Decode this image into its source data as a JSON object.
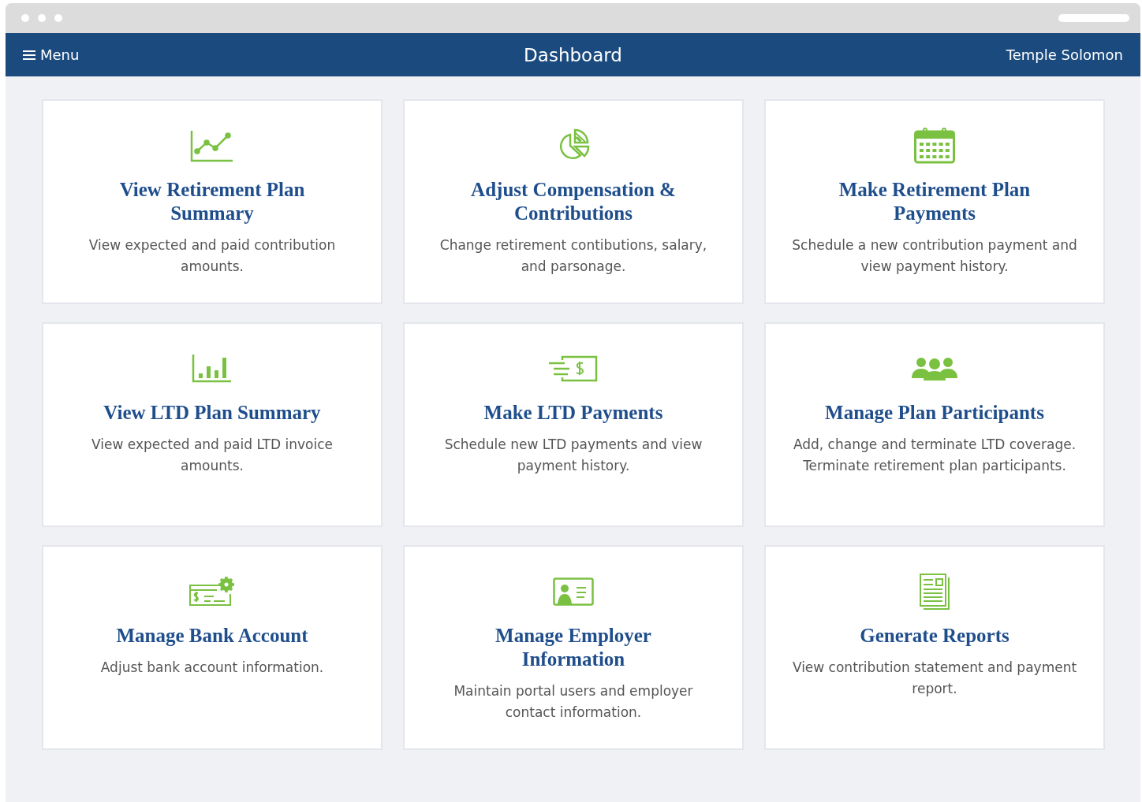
{
  "header": {
    "menu_label": "Menu",
    "title": "Dashboard",
    "user": "Temple Solomon"
  },
  "cards": [
    {
      "title": "View Retirement Plan Summary",
      "description": "View expected and paid contribution amounts."
    },
    {
      "title": "Adjust Compensation & Contributions",
      "description": "Change retirement contibutions, salary, and parsonage."
    },
    {
      "title": "Make Retirement Plan Payments",
      "description": "Schedule a new contribution payment and view payment history."
    },
    {
      "title": "View LTD Plan Summary",
      "description": "View expected and paid LTD invoice amounts."
    },
    {
      "title": "Make LTD Payments",
      "description": "Schedule new LTD payments and view payment history."
    },
    {
      "title": "Manage Plan Participants",
      "description": "Add, change and terminate LTD coverage. Terminate retirement plan participants."
    },
    {
      "title": "Manage Bank Account",
      "description": "Adjust bank account information."
    },
    {
      "title": "Manage Employer Information",
      "description": "Maintain portal users and employer contact information."
    },
    {
      "title": "Generate Reports",
      "description": "View contribution statement and payment report."
    }
  ]
}
